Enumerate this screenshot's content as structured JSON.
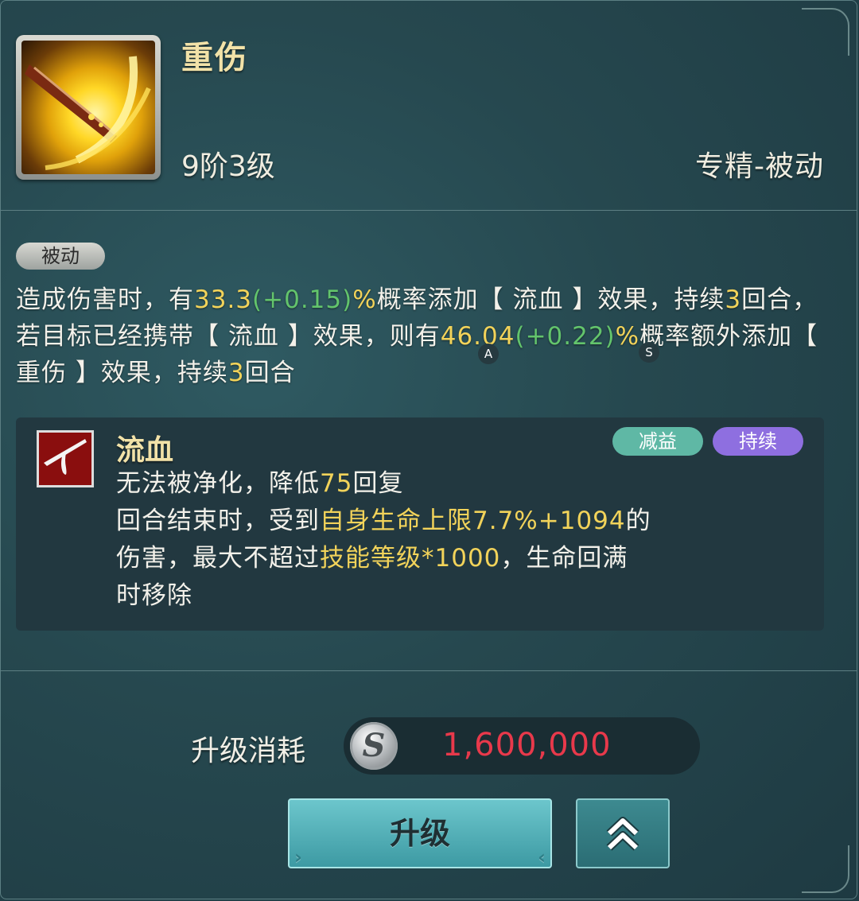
{
  "skill": {
    "name": "重伤",
    "level": "9阶3级",
    "type": "专精-被动",
    "icon": "golden-slash-icon"
  },
  "tag": {
    "label": "被动"
  },
  "description": {
    "p1": "造成伤害时，有",
    "v1": "33.3",
    "g1": "(+0.15)",
    "pct1": "%",
    "p2": "概率添加【 流血 】效果，持续",
    "v2": "3",
    "p3": "回合，若目标已经携带【 流血 】效果，则有",
    "v3": "46.04",
    "g2": "(+0.22)",
    "pct2": "%",
    "p4": "概率额外添加【 重伤 】效果，持续",
    "v4": "3",
    "p5": "回合",
    "marker_a": "A",
    "marker_s": "S"
  },
  "effect": {
    "name": "流血",
    "icon": "bleed-icon",
    "badge_debuff": "减益",
    "badge_duration": "持续",
    "l1a": "无法被净化，降低",
    "l1v": "75",
    "l1b": "回复",
    "l2a": "回合结束时，受到",
    "l2y": "自身生命上限7.7%+1094",
    "l2b": "的",
    "l3a": "伤害，最大不超过",
    "l3y": "技能等级*1000",
    "l3b": "，生命回满",
    "l4": "时移除"
  },
  "cost": {
    "label": "升级消耗",
    "currency_icon": "silver-coin-icon",
    "coin_letter": "S",
    "value": "1,600,000"
  },
  "buttons": {
    "upgrade": "升级",
    "max_upgrade_icon": "double-chevron-up-icon"
  },
  "colors": {
    "highlight": "#f2d35a",
    "growth": "#63c46c",
    "cost": "#e8394b",
    "badge_debuff": "#5fb8a5",
    "badge_duration": "#8e6fe0"
  }
}
